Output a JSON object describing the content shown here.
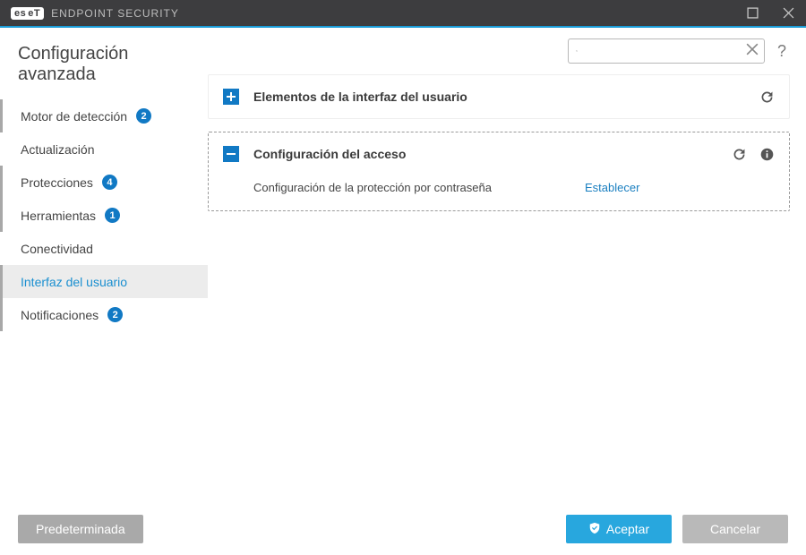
{
  "app": {
    "brand_prefix": "es",
    "brand_suffix": "eT",
    "product": "ENDPOINT SECURITY"
  },
  "header": {
    "title": "Configuración avanzada",
    "search_placeholder": ""
  },
  "sidebar": {
    "items": [
      {
        "label": "Motor de detección",
        "badge": "2",
        "marked": true,
        "active": false
      },
      {
        "label": "Actualización",
        "badge": null,
        "marked": false,
        "active": false
      },
      {
        "label": "Protecciones",
        "badge": "4",
        "marked": true,
        "active": false
      },
      {
        "label": "Herramientas",
        "badge": "1",
        "marked": true,
        "active": false
      },
      {
        "label": "Conectividad",
        "badge": null,
        "marked": false,
        "active": false
      },
      {
        "label": "Interfaz del usuario",
        "badge": null,
        "marked": true,
        "active": true
      },
      {
        "label": "Notificaciones",
        "badge": "2",
        "marked": true,
        "active": false
      }
    ]
  },
  "panels": [
    {
      "title": "Elementos de la interfaz del usuario",
      "expanded": false,
      "show_reset": true,
      "show_info": false,
      "rows": []
    },
    {
      "title": "Configuración del acceso",
      "expanded": true,
      "show_reset": true,
      "show_info": true,
      "rows": [
        {
          "label": "Configuración de la protección por contraseña",
          "action": "Establecer"
        }
      ]
    }
  ],
  "footer": {
    "default_btn": "Predeterminada",
    "ok_btn": "Aceptar",
    "cancel_btn": "Cancelar"
  }
}
